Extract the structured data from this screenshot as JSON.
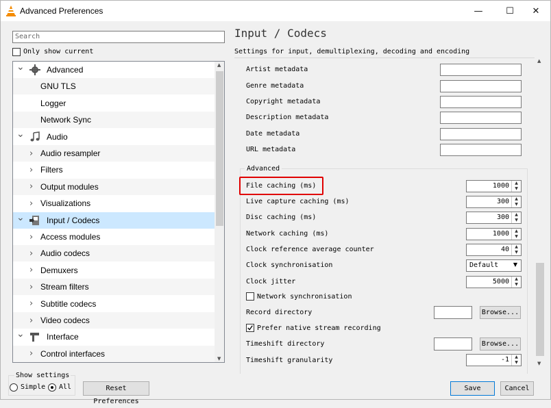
{
  "window": {
    "title": "Advanced Preferences",
    "minimize_glyph": "—",
    "maximize_glyph": "☐",
    "close_glyph": "✕"
  },
  "sidebar": {
    "search_placeholder": "Search",
    "only_show_current": "Only show current",
    "tree": [
      {
        "label": "Advanced",
        "icon": "gear-icon",
        "expanded": true
      },
      {
        "label": "GNU TLS"
      },
      {
        "label": "Logger"
      },
      {
        "label": "Network Sync"
      },
      {
        "label": "Audio",
        "icon": "music-note-icon",
        "expanded": true
      },
      {
        "label": "Audio resampler",
        "collapsed": true
      },
      {
        "label": "Filters",
        "collapsed": true
      },
      {
        "label": "Output modules",
        "collapsed": true
      },
      {
        "label": "Visualizations",
        "collapsed": true
      },
      {
        "label": "Input / Codecs",
        "icon": "input-codecs-icon",
        "expanded": true,
        "selected": true
      },
      {
        "label": "Access modules",
        "collapsed": true
      },
      {
        "label": "Audio codecs",
        "collapsed": true
      },
      {
        "label": "Demuxers",
        "collapsed": true
      },
      {
        "label": "Stream filters",
        "collapsed": true
      },
      {
        "label": "Subtitle codecs",
        "collapsed": true
      },
      {
        "label": "Video codecs",
        "collapsed": true
      },
      {
        "label": "Interface",
        "icon": "interface-icon",
        "expanded": true
      },
      {
        "label": "Control interfaces",
        "collapsed": true
      }
    ]
  },
  "panel": {
    "title": "Input / Codecs",
    "description": "Settings for input, demultiplexing, decoding and encoding",
    "metadata": [
      "Artist metadata",
      "Genre metadata",
      "Copyright metadata",
      "Description metadata",
      "Date metadata",
      "URL metadata"
    ],
    "advanced_label": "Advanced",
    "spin_settings": [
      {
        "label": "File caching (ms)",
        "value": "1000"
      },
      {
        "label": "Live capture caching (ms)",
        "value": "300"
      },
      {
        "label": "Disc caching (ms)",
        "value": "300"
      },
      {
        "label": "Network caching (ms)",
        "value": "1000"
      },
      {
        "label": "Clock reference average counter",
        "value": "40"
      }
    ],
    "clock_sync": {
      "label": "Clock synchronisation",
      "value": "Default"
    },
    "clock_jitter": {
      "label": "Clock jitter",
      "value": "5000"
    },
    "network_sync": {
      "label": "Network synchronisation",
      "checked": false
    },
    "record_directory": {
      "label": "Record directory",
      "browse": "Browse..."
    },
    "prefer_native": {
      "label": "Prefer native stream recording",
      "checked": true
    },
    "timeshift_directory": {
      "label": "Timeshift directory",
      "browse": "Browse..."
    },
    "timeshift_granularity": {
      "label": "Timeshift granularity",
      "value": "-1"
    }
  },
  "footer": {
    "show_settings": "Show settings",
    "simple": "Simple",
    "all": "All",
    "selected_mode": "All",
    "reset": "Reset Preferences",
    "save": "Save",
    "cancel": "Cancel"
  },
  "colors": {
    "highlight": "#e00000",
    "selection": "#cce8ff",
    "default_button_border": "#0078d7"
  }
}
